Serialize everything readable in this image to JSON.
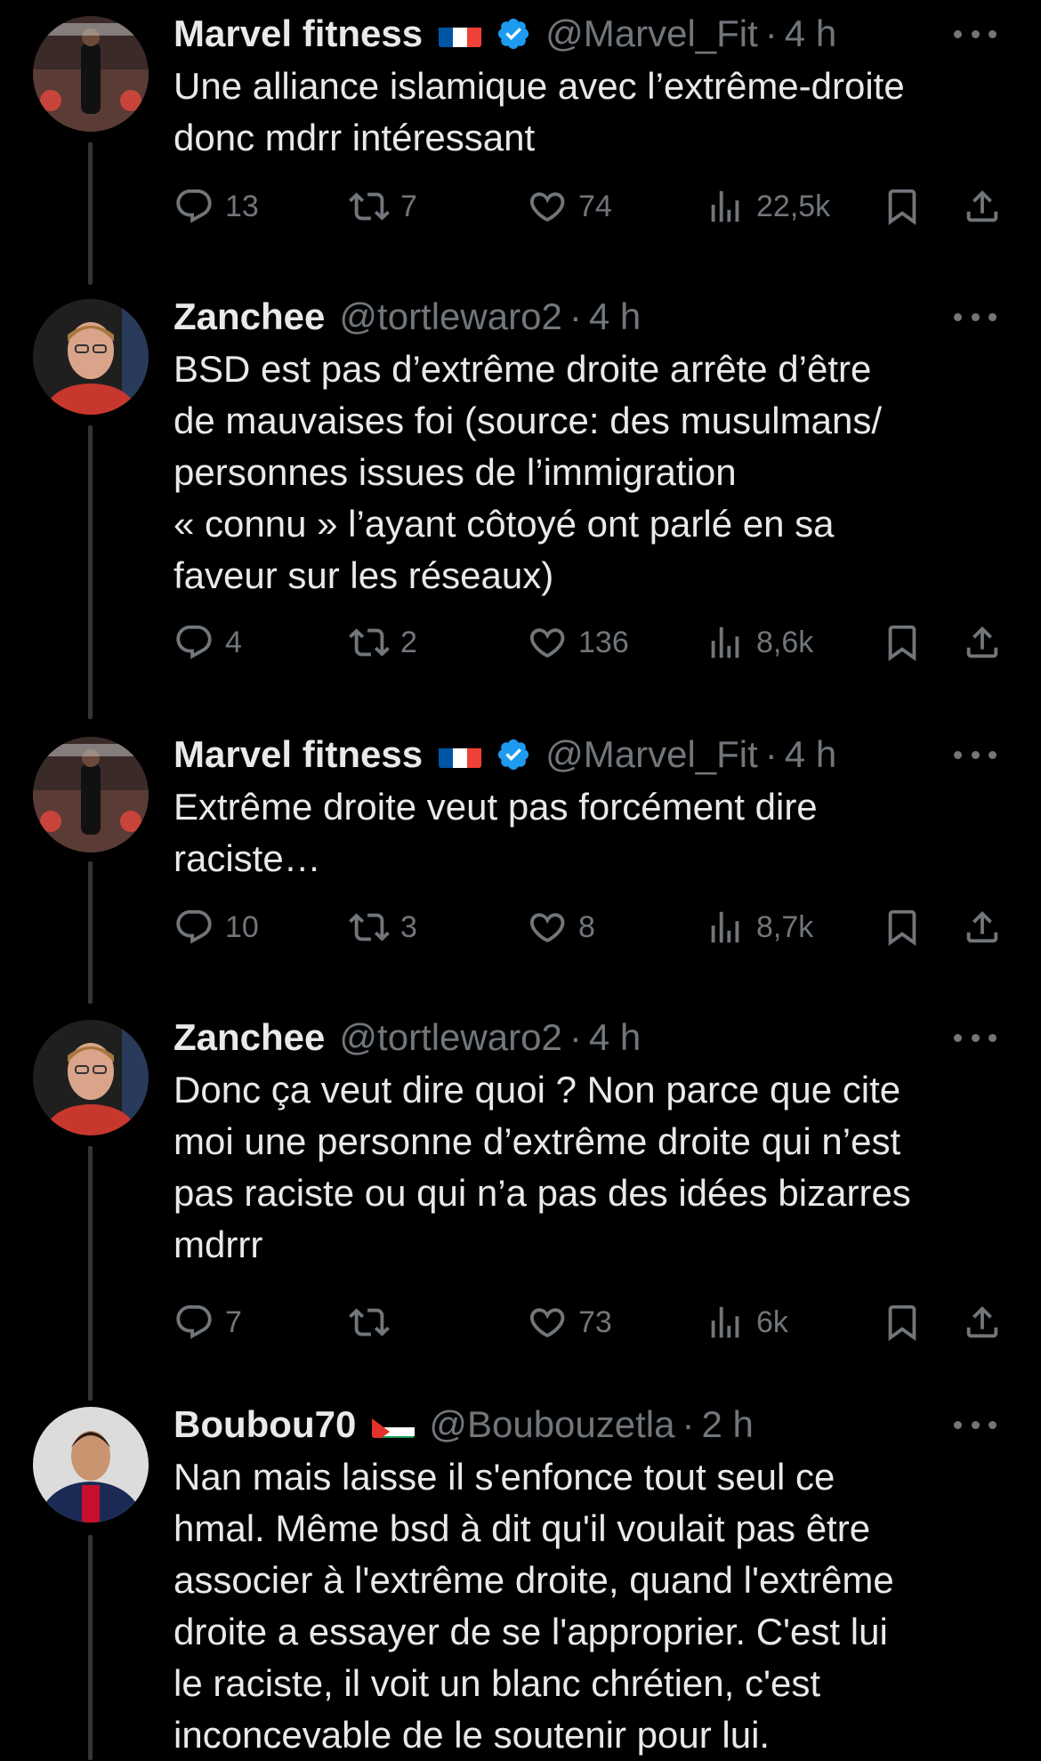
{
  "tweets": [
    {
      "name": "Marvel fitness",
      "flag": "fr",
      "verified": true,
      "handle": "@Marvel_Fit",
      "time": "4 h",
      "text": "Une alliance islamique avec l’extrême-droite\ndonc mdrr intéressant",
      "replies": "13",
      "retweets": "7",
      "likes": "74",
      "views": "22,5k"
    },
    {
      "name": "Zanchee",
      "flag": "",
      "verified": false,
      "handle": "@tortlewaro2",
      "time": "4 h",
      "text": "BSD est pas d’extrême droite arrête d’être\nde mauvaises foi (source: des musulmans/\npersonnes issues de l’immigration\n« connu » l’ayant côtoyé ont parlé en sa\nfaveur sur les réseaux)",
      "replies": "4",
      "retweets": "2",
      "likes": "136",
      "views": "8,6k"
    },
    {
      "name": "Marvel fitness",
      "flag": "fr",
      "verified": true,
      "handle": "@Marvel_Fit",
      "time": "4 h",
      "text": "Extrême droite veut pas forcément dire\nraciste…",
      "replies": "10",
      "retweets": "3",
      "likes": "8",
      "views": "8,7k"
    },
    {
      "name": "Zanchee",
      "flag": "",
      "verified": false,
      "handle": "@tortlewaro2",
      "time": "4 h",
      "text": "Donc ça veut dire quoi ? Non parce que cite\nmoi une personne d’extrême droite qui n’est\npas raciste ou qui n’a pas des idées bizarres\nmdrrr",
      "replies": "7",
      "retweets": "",
      "likes": "73",
      "views": "6k"
    },
    {
      "name": "Boubou70",
      "flag": "ps",
      "verified": false,
      "handle": "@Boubouzetla",
      "time": "2 h",
      "text": "Nan mais laisse il s'enfonce tout seul ce\nhmal. Même bsd à dit qu'il voulait pas être\nassocier à l'extrême droite, quand l'extrême\ndroite a essayer de se l'approprier. C'est lui\nle raciste, il voit un blanc chrétien, c'est\ninconcevable de le soutenir pour lui."
    }
  ],
  "colors": {
    "background": "#000000",
    "text": "#e7e9ea",
    "muted": "#71767b",
    "verified": "#1d9bf0",
    "thread_line": "#333639"
  },
  "icons": [
    "reply-icon",
    "retweet-icon",
    "like-icon",
    "views-icon",
    "bookmark-icon",
    "share-icon",
    "more-icon",
    "verified-badge-icon"
  ]
}
